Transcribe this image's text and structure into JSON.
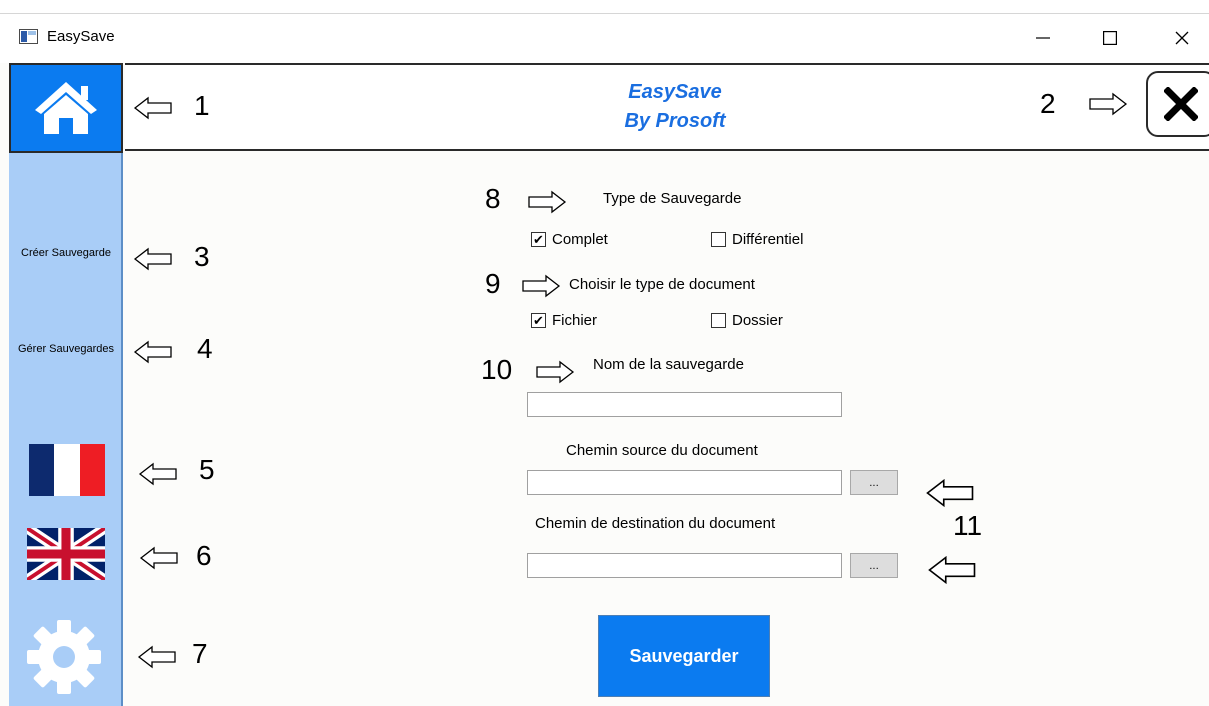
{
  "window": {
    "title": "EasySave",
    "minimize": "—",
    "maximize": "☐",
    "close": "✕"
  },
  "header": {
    "brand_line1": "EasySave",
    "brand_line2": "By Prosoft"
  },
  "sidebar": {
    "create_label": "Créer Sauvegarde",
    "manage_label": "Gérer Sauvegardes",
    "icons": [
      "home-icon",
      "french-flag-icon",
      "uk-flag-icon",
      "gear-icon"
    ]
  },
  "annotations": {
    "n1": "1",
    "n2": "2",
    "n3": "3",
    "n4": "4",
    "n5": "5",
    "n6": "6",
    "n7": "7",
    "n8": "8",
    "n9": "9",
    "n10": "10",
    "n11": "11"
  },
  "form": {
    "backup_type_label": "Type de Sauvegarde",
    "backup_types": [
      {
        "label": "Complet",
        "checked": true
      },
      {
        "label": "Différentiel",
        "checked": false
      }
    ],
    "document_type_label": "Choisir le type de document",
    "document_types": [
      {
        "label": "Fichier",
        "checked": true
      },
      {
        "label": "Dossier",
        "checked": false
      }
    ],
    "name_label": "Nom de la sauvegarde",
    "name_value": "",
    "source_label": "Chemin source du document",
    "source_value": "",
    "source_browse": "...",
    "dest_label": "Chemin de destination du document",
    "dest_value": "",
    "dest_browse": "...",
    "check_mark": "✔",
    "save_label": "Sauvegarder"
  },
  "colors": {
    "accent": "#0b7bf0",
    "sidebar": "#a9cdf7",
    "brand_text": "#1a6ee0"
  }
}
